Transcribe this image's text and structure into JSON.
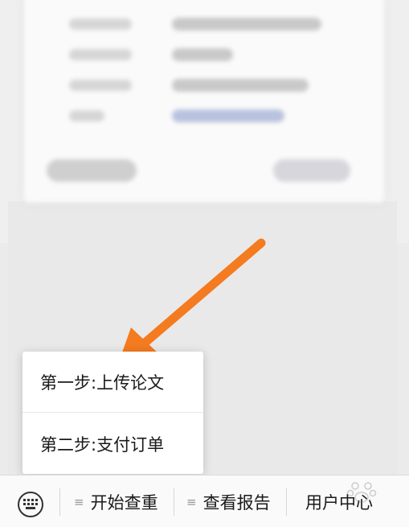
{
  "menu_popup": {
    "items": [
      {
        "label": "第一步:上传论文"
      },
      {
        "label": "第二步:支付订单"
      }
    ]
  },
  "bottom_bar": {
    "tabs": [
      {
        "label": "开始查重",
        "icon": "menu-lines-icon"
      },
      {
        "label": "查看报告",
        "icon": "menu-lines-icon"
      },
      {
        "label": "用户中心"
      }
    ],
    "keyboard_icon": "keyboard-icon"
  },
  "annotation": {
    "arrow_color": "#f47b20"
  }
}
